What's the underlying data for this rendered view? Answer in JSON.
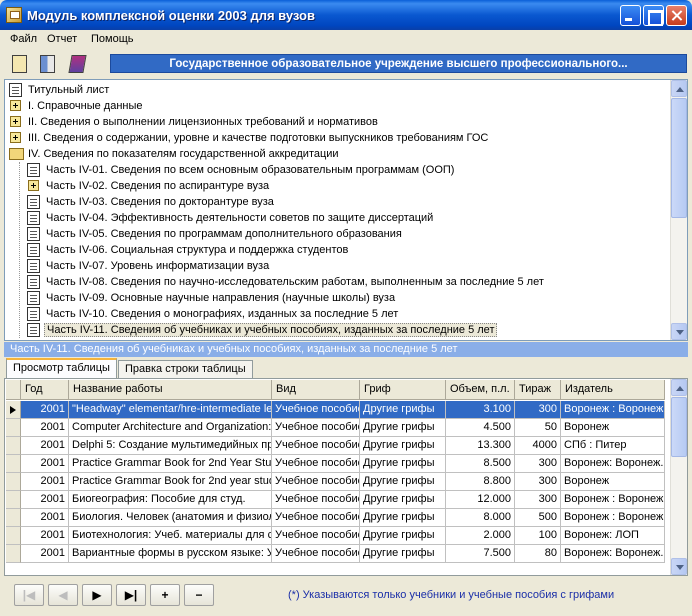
{
  "window": {
    "title": "Модуль комплексной оценки 2003 для вузов"
  },
  "menu": [
    "Файл",
    "Отчет",
    "Помощь"
  ],
  "toolbar": {
    "banner": "Государственное образовательное учреждение высшего профессионального..."
  },
  "tree": {
    "items": [
      {
        "label": "Титульный лист",
        "level": 0,
        "icon": "page-icon"
      },
      {
        "label": "I. Справочные данные",
        "level": 0,
        "icon": "plus-folder-icon"
      },
      {
        "label": "II. Сведения о выполнении лицензионных требований и нормативов",
        "level": 0,
        "icon": "plus-folder-icon"
      },
      {
        "label": "III. Сведения о содержании, уровне и качестве подготовки выпускников требованиям ГОС",
        "level": 0,
        "icon": "plus-folder-icon"
      },
      {
        "label": "IV. Сведения по показателям государственной аккредитации",
        "level": 0,
        "icon": "open-folder-icon"
      },
      {
        "label": "Часть IV-01. Сведения по всем основным образовательным программам (ООП)",
        "level": 1,
        "icon": "page-icon"
      },
      {
        "label": "Часть IV-02. Сведения по аспирантуре вуза",
        "level": 1,
        "icon": "plus-folder-icon"
      },
      {
        "label": "Часть IV-03. Сведения по докторантуре вуза",
        "level": 1,
        "icon": "page-icon"
      },
      {
        "label": "Часть IV-04. Эффективность деятельности советов по защите диссертаций",
        "level": 1,
        "icon": "page-icon"
      },
      {
        "label": "Часть IV-05. Сведения по программам дополнительного образования",
        "level": 1,
        "icon": "page-icon"
      },
      {
        "label": "Часть IV-06. Социальная структура и поддержка студентов",
        "level": 1,
        "icon": "page-icon"
      },
      {
        "label": "Часть IV-07. Уровень информатизации вуза",
        "level": 1,
        "icon": "page-icon"
      },
      {
        "label": "Часть IV-08. Сведения по научно-исследовательским работам, выполненным за последние 5 лет",
        "level": 1,
        "icon": "page-icon"
      },
      {
        "label": "Часть IV-09. Основные научные направления (научные школы) вуза",
        "level": 1,
        "icon": "page-icon"
      },
      {
        "label": "Часть IV-10. Сведения о монографиях, изданных за последние 5 лет",
        "level": 1,
        "icon": "page-icon"
      },
      {
        "label": "Часть IV-11. Сведения об учебниках и учебных пособиях, изданных за последние 5 лет",
        "level": 1,
        "icon": "page-icon",
        "selected": true
      }
    ]
  },
  "caption": "Часть IV-11. Сведения об учебниках и учебных пособиях, изданных за последние 5 лет",
  "tabs": [
    "Просмотр таблицы",
    "Правка строки таблицы"
  ],
  "table": {
    "columns": [
      "Год",
      "Название работы",
      "Вид",
      "Гриф",
      "Объем, п.л.",
      "Тираж",
      "Издатель"
    ],
    "rows": [
      [
        "2001",
        "\"Headway\" elementar/hre-intermediate lex",
        "Учебное пособие",
        "Другие грифы",
        "3.100",
        "300",
        "Воронеж : Воронеж"
      ],
      [
        "2001",
        "Computer Architecture and Organization: У",
        "Учебное пособие",
        "Другие грифы",
        "4.500",
        "50",
        "Воронеж"
      ],
      [
        "2001",
        "Delphi 5: Создание мультимедийных пр",
        "Учебное пособие",
        "Другие грифы",
        "13.300",
        "4000",
        "СПб : Питер"
      ],
      [
        "2001",
        "Practice Grammar Book for 2nd Year Stude",
        "Учебное пособие",
        "Другие грифы",
        "8.500",
        "300",
        "Воронеж: Воронеж."
      ],
      [
        "2001",
        "Practice Grammar Book for 2nd year stude",
        "Учебное пособие",
        "Другие грифы",
        "8.800",
        "300",
        "Воронеж"
      ],
      [
        "2001",
        "Биогеография: Пособие для студ.",
        "Учебное пособие",
        "Другие грифы",
        "12.000",
        "300",
        "Воронеж : Воронеж"
      ],
      [
        "2001",
        "Биология. Человек (анатомия и физиол",
        "Учебное пособие",
        "Другие грифы",
        "8.000",
        "500",
        "Воронеж : Воронеж"
      ],
      [
        "2001",
        "Биотехнология: Учеб. материалы для с",
        "Учебное пособие",
        "Другие грифы",
        "2.000",
        "100",
        "Воронеж: ЛОП"
      ],
      [
        "2001",
        "Вариантные формы в русском языке: У",
        "Учебное пособие",
        "Другие грифы",
        "7.500",
        "80",
        "Воронеж: Воронеж."
      ]
    ]
  },
  "nav": {
    "first": "|◀",
    "prev": "◀",
    "next": "▶",
    "last": "▶|",
    "add": "+",
    "remove": "−"
  },
  "note": "(*) Указываются только учебники и учебные пособия с грифами"
}
